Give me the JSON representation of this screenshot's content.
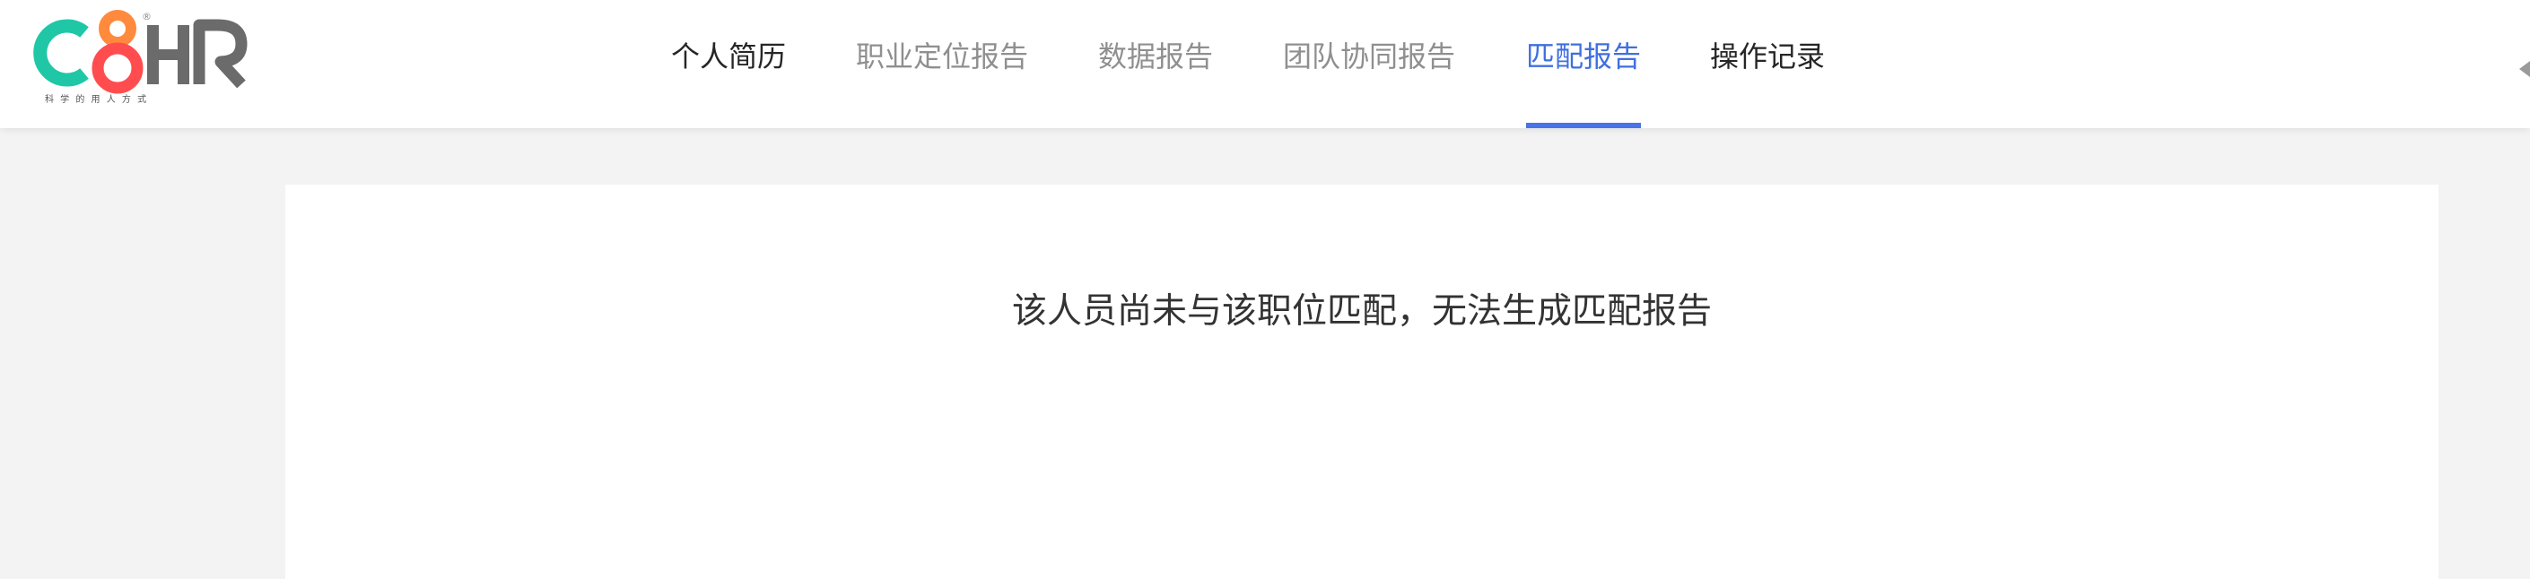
{
  "brand": {
    "logo_text": "C8HR",
    "logo_tagline": "科 学 的 用 人 方 式",
    "registered_mark": "®",
    "colors": {
      "teal": "#1fc7a6",
      "orange": "#ff8a3d",
      "red": "#ff4d4f",
      "gray": "#6b6b6b"
    }
  },
  "nav": {
    "tabs": [
      {
        "label": "个人简历",
        "state": "default-dark"
      },
      {
        "label": "职业定位报告",
        "state": "default"
      },
      {
        "label": "数据报告",
        "state": "default"
      },
      {
        "label": "团队协同报告",
        "state": "default"
      },
      {
        "label": "匹配报告",
        "state": "active"
      },
      {
        "label": "操作记录",
        "state": "default-dark"
      }
    ],
    "active_color": "#3f6fe0"
  },
  "main": {
    "message": "该人员尚未与该职位匹配，无法生成匹配报告"
  },
  "icons": {
    "collapse": "collapse-arrow-icon"
  }
}
